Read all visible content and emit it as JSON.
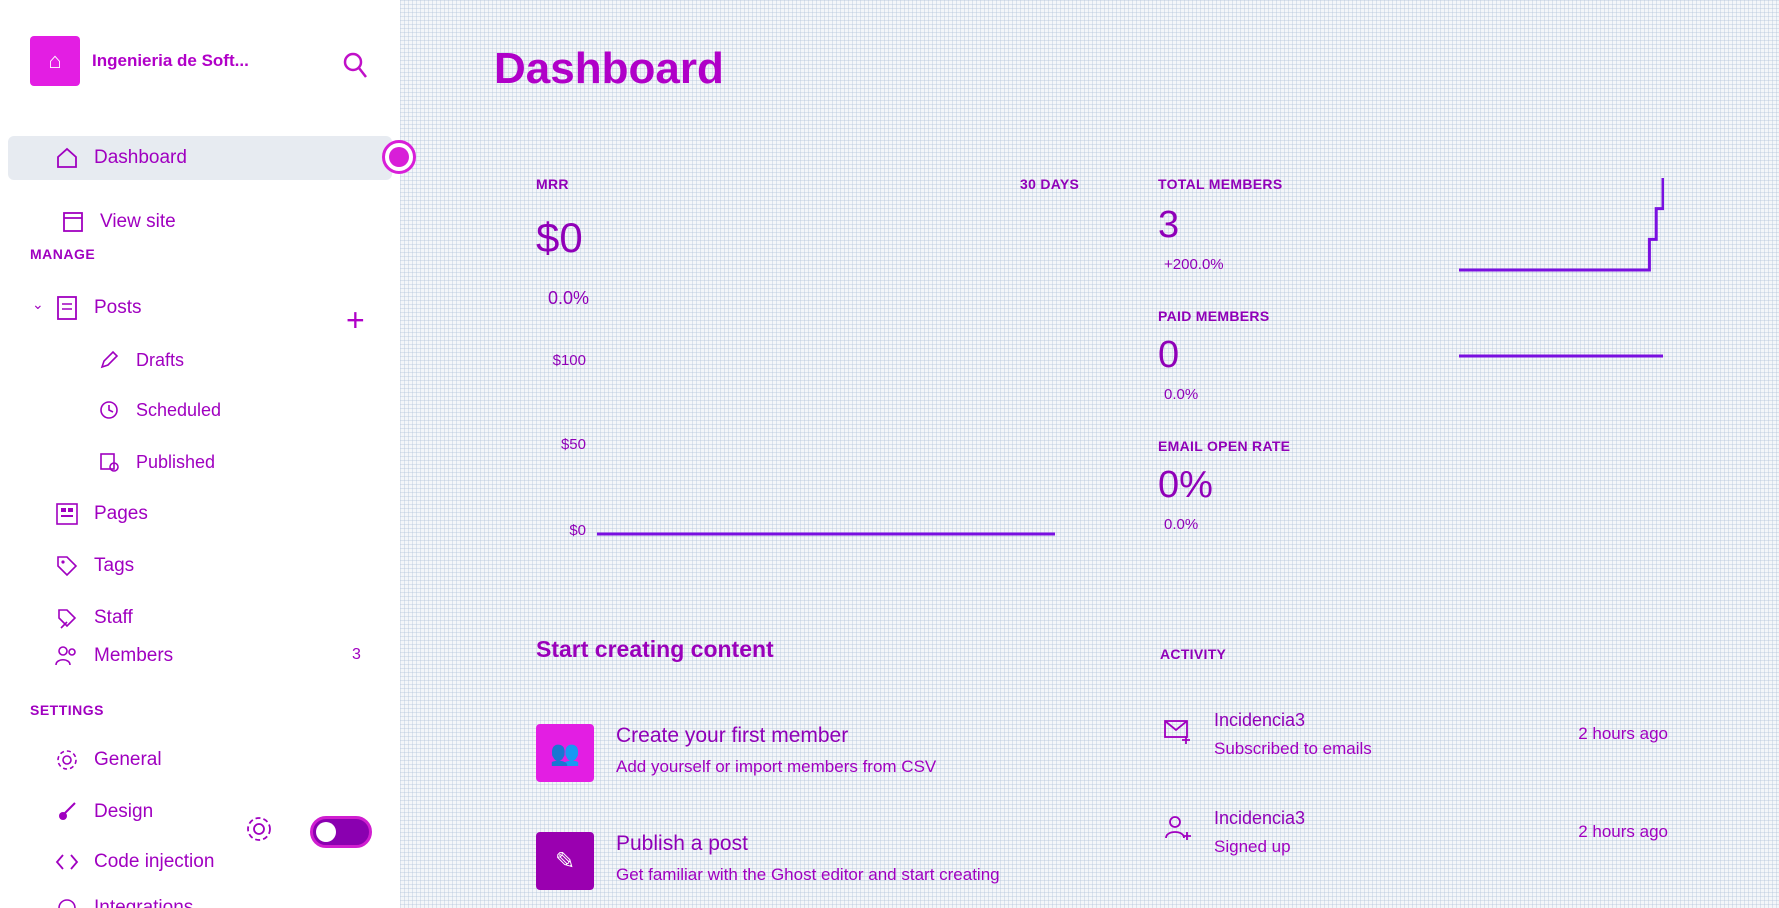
{
  "sidebar": {
    "brand": {
      "name": "Ingenieria de Soft..."
    },
    "nav": {
      "dashboard": "Dashboard",
      "view_site": "View site"
    },
    "manage_label": "MANAGE",
    "manage": {
      "posts": "Posts",
      "drafts": "Drafts",
      "scheduled": "Scheduled",
      "published": "Published",
      "pages": "Pages",
      "tags": "Tags",
      "staff": "Staff",
      "members": "Members",
      "members_count": "3"
    },
    "settings_label": "SETTINGS",
    "settings": {
      "general": "General",
      "design": "Design",
      "code_injection": "Code injection",
      "integrations": "Integrations"
    }
  },
  "main": {
    "title": "Dashboard",
    "mrr": {
      "label": "MRR",
      "period": "30 DAYS",
      "value": "$0",
      "change": "0.0%",
      "axis": [
        "$100",
        "$50",
        "$0"
      ]
    },
    "total_members": {
      "label": "TOTAL MEMBERS",
      "value": "3",
      "change": "+200.0%"
    },
    "paid_members": {
      "label": "PAID MEMBERS",
      "value": "0",
      "change": "0.0%"
    },
    "email_open_rate": {
      "label": "EMAIL OPEN RATE",
      "value": "0%",
      "change": "0.0%"
    },
    "start_title": "Start creating content",
    "tasks": [
      {
        "title": "Create your first member",
        "desc": "Add yourself or import members from CSV"
      },
      {
        "title": "Publish a post",
        "desc": "Get familiar with the Ghost editor and start creating"
      }
    ],
    "activity_title": "ACTIVITY",
    "activity": [
      {
        "name": "Incidencia3",
        "desc": "Subscribed to emails",
        "time": "2 hours ago"
      },
      {
        "name": "Incidencia3",
        "desc": "Signed up",
        "time": "2 hours ago"
      }
    ]
  },
  "chart_data": [
    {
      "type": "line",
      "title": "MRR",
      "series": [
        {
          "values": [
            0,
            0,
            0,
            0,
            0,
            0,
            0,
            0,
            0,
            0,
            0,
            0,
            0,
            0,
            0,
            0,
            0,
            0,
            0,
            0,
            0,
            0,
            0,
            0,
            0,
            0,
            0,
            0,
            0,
            0
          ]
        }
      ],
      "ylim": [
        0,
        100
      ],
      "yticks": [
        "$100",
        "$50",
        "$0"
      ]
    },
    {
      "type": "line",
      "title": "TOTAL MEMBERS",
      "series": [
        {
          "values": [
            0,
            0,
            0,
            0,
            0,
            0,
            0,
            0,
            0,
            0,
            0,
            0,
            0,
            0,
            0,
            0,
            0,
            0,
            0,
            0,
            0,
            0,
            0,
            0,
            0,
            0,
            0,
            0,
            1,
            2,
            3
          ]
        }
      ]
    },
    {
      "type": "line",
      "title": "PAID MEMBERS",
      "series": [
        {
          "values": [
            0,
            0,
            0,
            0,
            0,
            0,
            0,
            0,
            0,
            0,
            0,
            0,
            0,
            0,
            0,
            0,
            0,
            0,
            0,
            0,
            0,
            0,
            0,
            0,
            0,
            0,
            0,
            0,
            0,
            0
          ]
        }
      ]
    }
  ],
  "colors": {
    "accent": "#b000c8",
    "chart_line": "#7a10e0",
    "pink": "#e31ee3"
  }
}
